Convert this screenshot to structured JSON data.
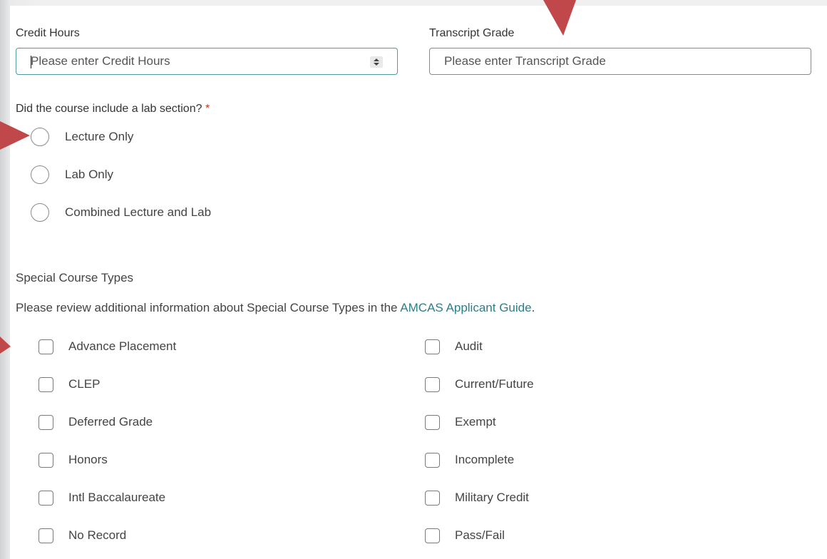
{
  "credit_hours": {
    "label": "Credit Hours",
    "placeholder": "Please enter Credit Hours"
  },
  "transcript_grade": {
    "label": "Transcript Grade",
    "placeholder": "Please enter Transcript Grade"
  },
  "lab_question": {
    "label": "Did the course include a lab section?",
    "required_mark": "*",
    "options": [
      {
        "label": "Lecture Only"
      },
      {
        "label": "Lab Only"
      },
      {
        "label": "Combined Lecture and Lab"
      }
    ]
  },
  "special_types": {
    "heading": "Special Course Types",
    "info_prefix": "Please review additional information about Special Course Types in the ",
    "info_link": "AMCAS Applicant Guide",
    "info_suffix": ".",
    "left_column": [
      {
        "label": "Advance Placement"
      },
      {
        "label": "CLEP"
      },
      {
        "label": "Deferred Grade"
      },
      {
        "label": "Honors"
      },
      {
        "label": "Intl Baccalaureate"
      },
      {
        "label": "No Record"
      }
    ],
    "right_column": [
      {
        "label": "Audit"
      },
      {
        "label": "Current/Future"
      },
      {
        "label": "Exempt"
      },
      {
        "label": "Incomplete"
      },
      {
        "label": "Military Credit"
      },
      {
        "label": "Pass/Fail"
      }
    ]
  },
  "colors": {
    "accent": "#4f9a9e",
    "link": "#2f7e87",
    "required": "#c0392b",
    "annotation_arrow": "#c0474a"
  },
  "icons": {
    "spinner": "up-down-spinner-icon",
    "annotation": "red-arrow-icon"
  }
}
